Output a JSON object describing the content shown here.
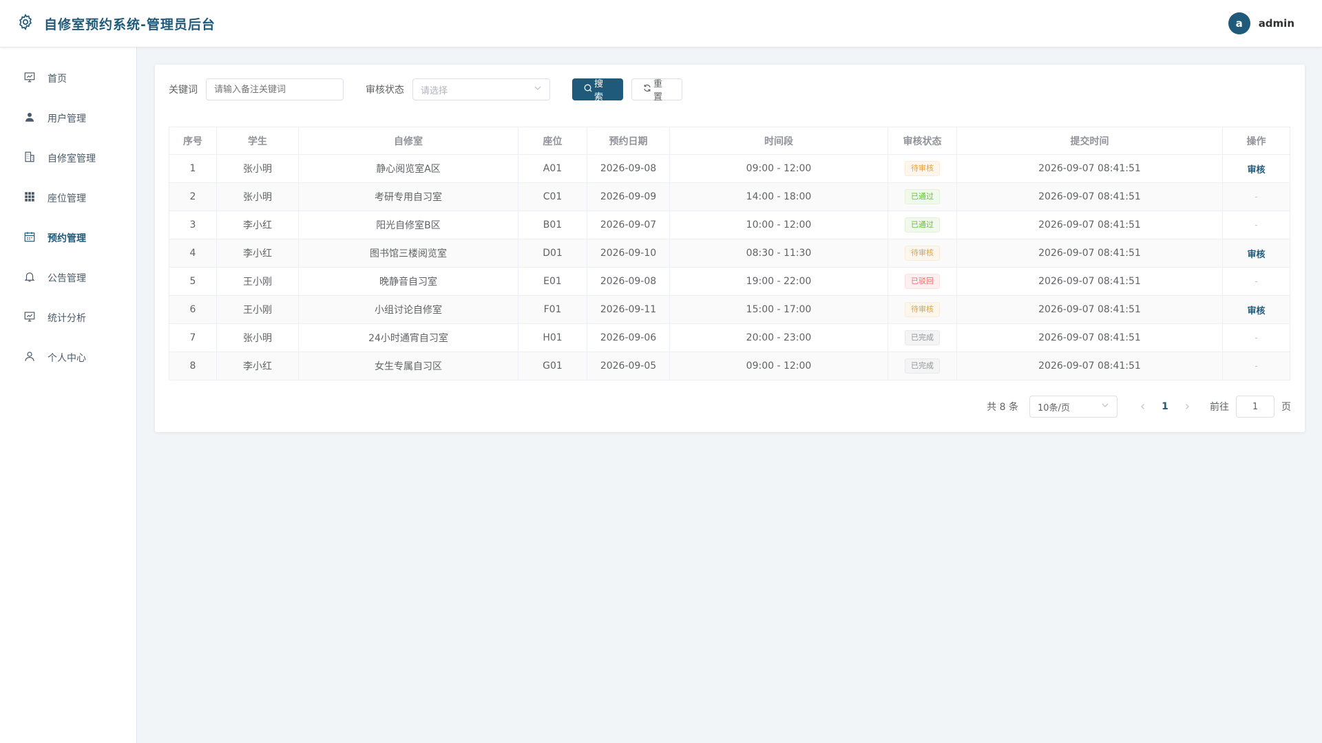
{
  "header": {
    "title": "自修室预约系统-管理员后台",
    "avatar_letter": "a",
    "username": "admin"
  },
  "sidebar": {
    "items": [
      {
        "label": "首页",
        "icon": "dashboard-icon"
      },
      {
        "label": "用户管理",
        "icon": "user-icon"
      },
      {
        "label": "自修室管理",
        "icon": "building-icon"
      },
      {
        "label": "座位管理",
        "icon": "grid-icon"
      },
      {
        "label": "预约管理",
        "icon": "calendar-icon",
        "active": true
      },
      {
        "label": "公告管理",
        "icon": "bell-icon"
      },
      {
        "label": "统计分析",
        "icon": "chart-icon"
      },
      {
        "label": "个人中心",
        "icon": "person-icon"
      }
    ]
  },
  "filters": {
    "keyword_label": "关键词",
    "keyword_placeholder": "请输入备注关键词",
    "status_label": "审核状态",
    "status_placeholder": "请选择",
    "search_label": "搜索",
    "reset_label": "重置"
  },
  "table": {
    "columns": [
      "序号",
      "学生",
      "自修室",
      "座位",
      "预约日期",
      "时间段",
      "审核状态",
      "提交时间",
      "操作"
    ],
    "rows": [
      {
        "no": "1",
        "student": "张小明",
        "room": "静心阅览室A区",
        "seat": "A01",
        "date": "2026-09-08",
        "time": "09:00 - 12:00",
        "status": "待审核",
        "status_type": "pending",
        "submitted": "2026-09-07 08:41:51",
        "op": "审核"
      },
      {
        "no": "2",
        "student": "张小明",
        "room": "考研专用自习室",
        "seat": "C01",
        "date": "2026-09-09",
        "time": "14:00 - 18:00",
        "status": "已通过",
        "status_type": "pass",
        "submitted": "2026-09-07 08:41:51",
        "op": "-"
      },
      {
        "no": "3",
        "student": "李小红",
        "room": "阳光自修室B区",
        "seat": "B01",
        "date": "2026-09-07",
        "time": "10:00 - 12:00",
        "status": "已通过",
        "status_type": "pass",
        "submitted": "2026-09-07 08:41:51",
        "op": "-"
      },
      {
        "no": "4",
        "student": "李小红",
        "room": "图书馆三楼阅览室",
        "seat": "D01",
        "date": "2026-09-10",
        "time": "08:30 - 11:30",
        "status": "待审核",
        "status_type": "pending",
        "submitted": "2026-09-07 08:41:51",
        "op": "审核"
      },
      {
        "no": "5",
        "student": "王小刚",
        "room": "晚静音自习室",
        "seat": "E01",
        "date": "2026-09-08",
        "time": "19:00 - 22:00",
        "status": "已驳回",
        "status_type": "reject",
        "submitted": "2026-09-07 08:41:51",
        "op": "-"
      },
      {
        "no": "6",
        "student": "王小刚",
        "room": "小组讨论自修室",
        "seat": "F01",
        "date": "2026-09-11",
        "time": "15:00 - 17:00",
        "status": "待审核",
        "status_type": "pending",
        "submitted": "2026-09-07 08:41:51",
        "op": "审核"
      },
      {
        "no": "7",
        "student": "张小明",
        "room": "24小时通宵自习室",
        "seat": "H01",
        "date": "2026-09-06",
        "time": "20:00 - 23:00",
        "status": "已完成",
        "status_type": "done",
        "submitted": "2026-09-07 08:41:51",
        "op": "-"
      },
      {
        "no": "8",
        "student": "李小红",
        "room": "女生专属自习区",
        "seat": "G01",
        "date": "2026-09-05",
        "time": "09:00 - 12:00",
        "status": "已完成",
        "status_type": "done",
        "submitted": "2026-09-07 08:41:51",
        "op": "-"
      }
    ]
  },
  "pagination": {
    "total_text": "共 8 条",
    "page_size": "10条/页",
    "current_page": "1",
    "goto_label": "前往",
    "goto_value": "1",
    "page_suffix": "页"
  },
  "colors": {
    "primary": "#1f5a7a",
    "pending": "#e6a23c",
    "pass": "#67c23a",
    "reject": "#f56c6c",
    "done": "#909399"
  }
}
